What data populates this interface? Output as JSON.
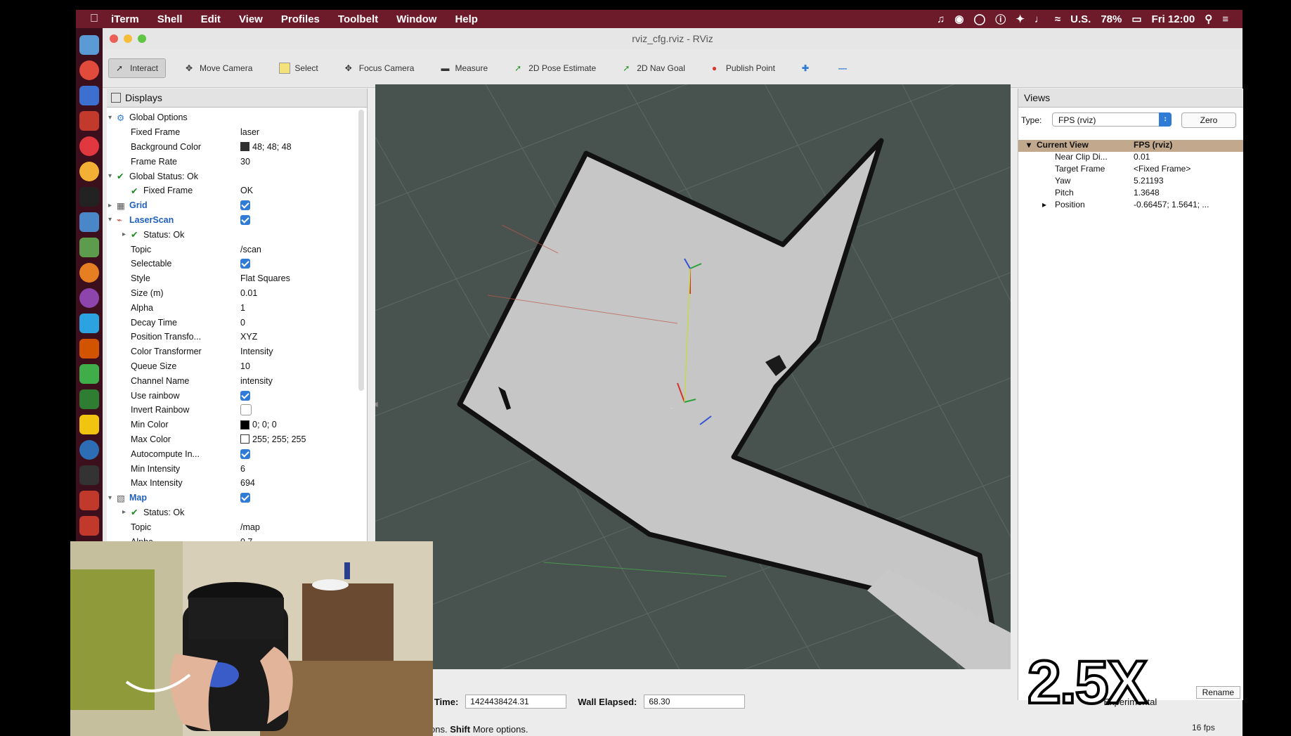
{
  "menubar": {
    "items": [
      "iTerm",
      "Shell",
      "Edit",
      "View",
      "Profiles",
      "Toolbelt",
      "Window",
      "Help"
    ],
    "locale": "U.S.",
    "battery": "78%",
    "clock": "Fri 12:00"
  },
  "window": {
    "title": "rviz_cfg.rviz - RViz"
  },
  "toolbar": {
    "tools": [
      "Interact",
      "Move Camera",
      "Select",
      "Focus Camera",
      "Measure",
      "2D Pose Estimate",
      "2D Nav Goal",
      "Publish Point"
    ]
  },
  "displays": {
    "title": "Displays",
    "rows": [
      {
        "label": "Global Options",
        "value": ""
      },
      {
        "label": "Fixed Frame",
        "value": "laser"
      },
      {
        "label": "Background Color",
        "value": "48; 48; 48"
      },
      {
        "label": "Frame Rate",
        "value": "30"
      },
      {
        "label": "Global Status: Ok",
        "value": ""
      },
      {
        "label": "Fixed Frame",
        "value": "OK"
      },
      {
        "label": "Grid",
        "value": ""
      },
      {
        "label": "LaserScan",
        "value": ""
      },
      {
        "label": "Status: Ok",
        "value": ""
      },
      {
        "label": "Topic",
        "value": "/scan"
      },
      {
        "label": "Selectable",
        "value": ""
      },
      {
        "label": "Style",
        "value": "Flat Squares"
      },
      {
        "label": "Size (m)",
        "value": "0.01"
      },
      {
        "label": "Alpha",
        "value": "1"
      },
      {
        "label": "Decay Time",
        "value": "0"
      },
      {
        "label": "Position Transfo...",
        "value": "XYZ"
      },
      {
        "label": "Color Transformer",
        "value": "Intensity"
      },
      {
        "label": "Queue Size",
        "value": "10"
      },
      {
        "label": "Channel Name",
        "value": "intensity"
      },
      {
        "label": "Use rainbow",
        "value": ""
      },
      {
        "label": "Invert Rainbow",
        "value": ""
      },
      {
        "label": "Min Color",
        "value": "0; 0; 0"
      },
      {
        "label": "Max Color",
        "value": "255; 255; 255"
      },
      {
        "label": "Autocompute In...",
        "value": ""
      },
      {
        "label": "Min Intensity",
        "value": "6"
      },
      {
        "label": "Max Intensity",
        "value": "694"
      },
      {
        "label": "Map",
        "value": ""
      },
      {
        "label": "Status: Ok",
        "value": ""
      },
      {
        "label": "Topic",
        "value": "/map"
      },
      {
        "label": "Alpha",
        "value": "0.7"
      }
    ]
  },
  "views": {
    "title": "Views",
    "type_label": "Type:",
    "type_value": "FPS (rviz)",
    "zero_button": "Zero",
    "current_view_label": "Current View",
    "current_view_value": "FPS (rviz)",
    "props": [
      {
        "label": "Near Clip Di...",
        "value": "0.01"
      },
      {
        "label": "Target Frame",
        "value": "<Fixed Frame>"
      },
      {
        "label": "Yaw",
        "value": "5.21193"
      },
      {
        "label": "Pitch",
        "value": "1.3648"
      },
      {
        "label": "Position",
        "value": "-0.66457; 1.5641; ..."
      }
    ],
    "rename_button": "Rename"
  },
  "timebar": {
    "wall_time_label": "Wall Time:",
    "wall_time_value": "1424438424.31",
    "wall_elapsed_label": "Wall Elapsed:",
    "wall_elapsed_value": "68.30",
    "experimental_label": "Experimental",
    "hint_prefix": "ons.",
    "hint_key": "Shift",
    "hint_text": "More options.",
    "fps": "16 fps"
  },
  "overlay": {
    "speed": "2.5X"
  },
  "colors": {
    "menubar": "#6d1a2a",
    "viewport": "#48524f",
    "map_free": "#c6c6c6",
    "accent": "#2f7bd6"
  }
}
